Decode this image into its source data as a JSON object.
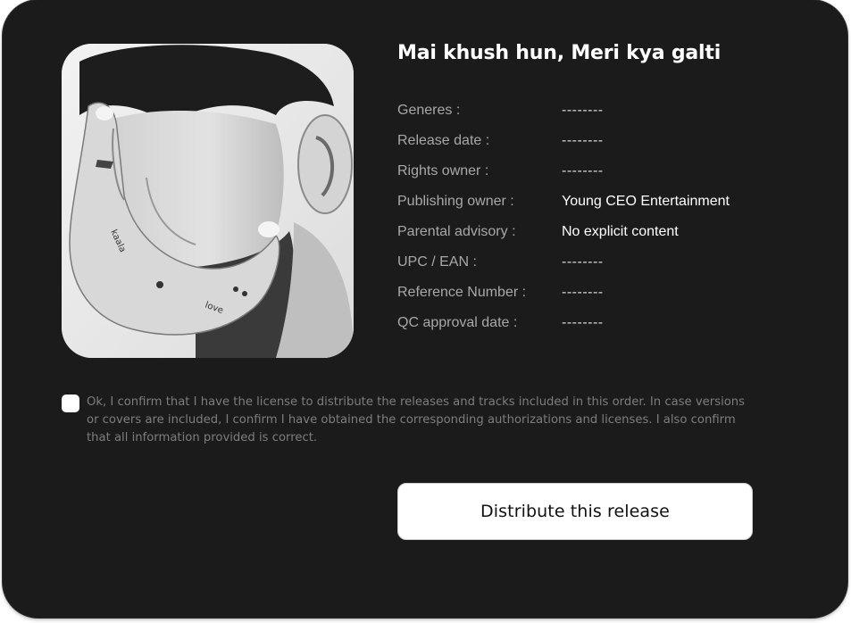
{
  "release": {
    "title": "Mai khush hun, Meri kya galti",
    "artwork_label": "cover-art-bw-portrait"
  },
  "details": [
    {
      "label": "Generes :",
      "value": "--------",
      "empty": true
    },
    {
      "label": "Release date :",
      "value": "--------",
      "empty": true
    },
    {
      "label": "Rights owner :",
      "value": "--------",
      "empty": true
    },
    {
      "label": "Publishing owner :",
      "value": "Young CEO Entertainment",
      "empty": false
    },
    {
      "label": "Parental advisory :",
      "value": "No explicit content",
      "empty": false
    },
    {
      "label": "UPC / EAN :",
      "value": "--------",
      "empty": true
    },
    {
      "label": "Reference Number :",
      "value": "--------",
      "empty": true
    },
    {
      "label": "QC approval date :",
      "value": "--------",
      "empty": true
    }
  ],
  "confirmation": {
    "checked": false,
    "text": "Ok, I confirm that I have the license to distribute the releases and tracks included in this order. In case versions or covers are included, I confirm I have obtained the corresponding authorizations and licenses. I also confirm that all information provided is correct."
  },
  "actions": {
    "distribute_label": "Distribute this release"
  },
  "colors": {
    "card_background": "#1b1b1b",
    "label_text": "#a8a8a8",
    "value_text": "#ffffff",
    "muted_text": "#7d7d7d",
    "button_background": "#ffffff"
  }
}
